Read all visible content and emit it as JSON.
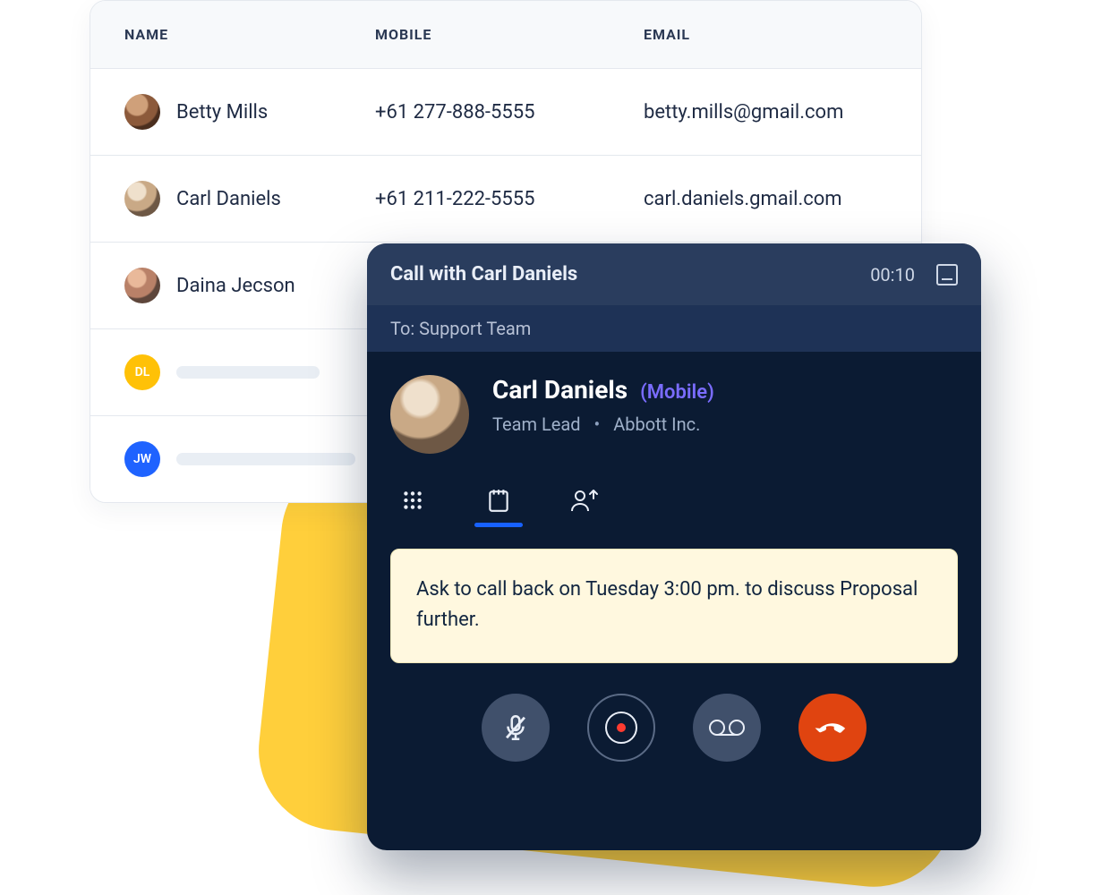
{
  "contacts": {
    "headers": {
      "name": "NAME",
      "mobile": "MOBILE",
      "email": "EMAIL"
    },
    "rows": [
      {
        "name": "Betty Mills",
        "mobile": "+61 277-888-5555",
        "email": "betty.mills@gmail.com",
        "avatar": "pic1"
      },
      {
        "name": "Carl Daniels",
        "mobile": "+61 211-222-5555",
        "email": "carl.daniels.gmail.com",
        "avatar": "pic2"
      },
      {
        "name": "Daina Jecson",
        "mobile": "",
        "email": "",
        "avatar": "pic3"
      },
      {
        "name": "",
        "initials": "DL",
        "avatar": "dl",
        "placeholder": true
      },
      {
        "name": "",
        "initials": "JW",
        "avatar": "jw",
        "placeholder": true
      }
    ]
  },
  "call": {
    "title": "Call with Carl Daniels",
    "timer": "00:10",
    "to_label": "To: Support Team",
    "contact": {
      "name": "Carl Daniels",
      "type": "(Mobile)",
      "role": "Team Lead",
      "company": "Abbott Inc."
    },
    "note": "Ask to call back on Tuesday 3:00 pm. to discuss Proposal further.",
    "tabs_active": "notes"
  }
}
